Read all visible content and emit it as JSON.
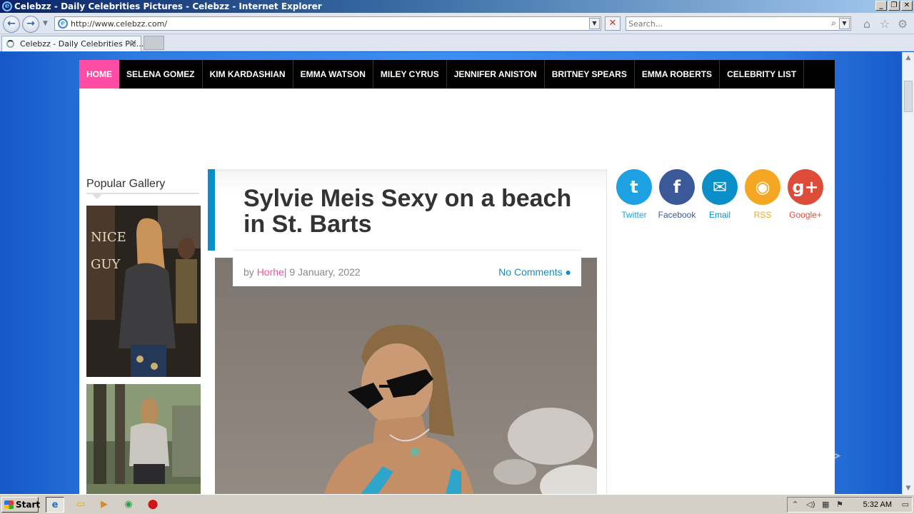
{
  "window": {
    "title": "Celebzz - Daily Celebrities Pictures - Celebzz - Internet Explorer",
    "controls": {
      "minimize": "_",
      "restore": "❐",
      "close": "✕"
    }
  },
  "browser": {
    "address": "http://www.celebzz.com/",
    "search_placeholder": "Search...",
    "tab_title": "Celebzz - Daily Celebrities Pic...",
    "tab_close": "✕"
  },
  "site": {
    "menu": [
      "HOME",
      "SELENA GOMEZ",
      "KIM KARDASHIAN",
      "EMMA WATSON",
      "MILEY CYRUS",
      "JENNIFER ANISTON",
      "BRITNEY SPEARS",
      "EMMA ROBERTS",
      "CELEBRITY LIST"
    ],
    "sidebar_title": "Popular Gallery",
    "post": {
      "title": "Sylvie Meis Sexy on a beach in St. Barts",
      "by_label": "by",
      "author": "Horhe",
      "date": "| 9 January, 2022",
      "comments": "No Comments"
    },
    "social": [
      {
        "label": "Twitter",
        "icon": "twitter-icon",
        "glyph": "t",
        "color": "#1da1e2",
        "text_color": "#1da1e2"
      },
      {
        "label": "Facebook",
        "icon": "facebook-icon",
        "glyph": "f",
        "color": "#3b5998",
        "text_color": "#3b5998"
      },
      {
        "label": "Email",
        "icon": "email-icon",
        "glyph": "✉",
        "color": "#0a8fc9",
        "text_color": "#0a8fc9"
      },
      {
        "label": "RSS",
        "icon": "rss-icon",
        "glyph": "◉",
        "color": "#f5a623",
        "text_color": "#f5a623"
      },
      {
        "label": "Google+",
        "icon": "google-plus-icon",
        "glyph": "g+",
        "color": "#dd4b39",
        "text_color": "#dd4b39"
      }
    ],
    "accent_color": "#ff4da6",
    "link_color": "#0a8fc9"
  },
  "watermark": "ANY ▷ RUN",
  "taskbar": {
    "start_label": "Start",
    "clock": "5:32 AM"
  }
}
